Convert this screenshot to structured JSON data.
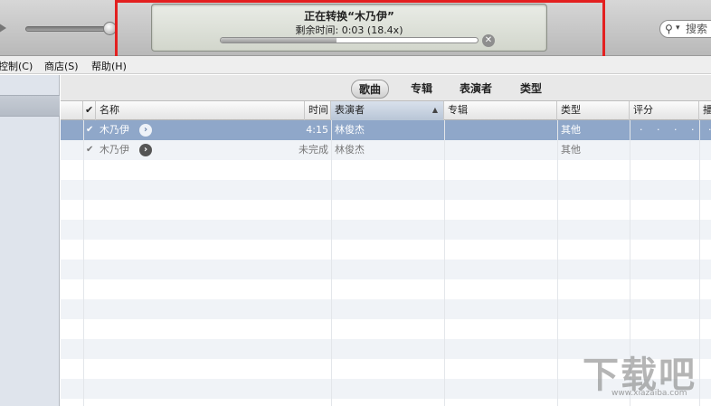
{
  "conversion": {
    "title": "正在转换“木乃伊”",
    "remaining_label": "剩余时间:",
    "remaining_value": "0:03 (18.4x)",
    "progress": 0.45,
    "cancel_glyph": "✕"
  },
  "search": {
    "placeholder": "搜索"
  },
  "menu": [
    "控制(C)",
    "商店(S)",
    "帮助(H)"
  ],
  "view_tabs": [
    "歌曲",
    "专辑",
    "表演者",
    "类型"
  ],
  "active_tab": "歌曲",
  "columns": {
    "check": "✔",
    "name": "名称",
    "time": "时间",
    "artist": "表演者",
    "album": "专辑",
    "genre": "类型",
    "rating": "评分",
    "extra": "播"
  },
  "tracks": [
    {
      "checked": "✔",
      "name": "木乃伊",
      "time": "4:15",
      "artist": "林俊杰",
      "album": "",
      "genre": "其他",
      "rating": "· · · · ·",
      "selected": true
    },
    {
      "checked": "✔",
      "name": "木乃伊",
      "time": "未完成",
      "artist": "林俊杰",
      "album": "",
      "genre": "其他",
      "rating": "",
      "selected": false
    }
  ],
  "watermark": {
    "text": "下载吧",
    "url": "www.xiazaiba.com"
  },
  "colors": {
    "highlight_border": "#e32020",
    "selected_row": "#8fa7c9"
  }
}
